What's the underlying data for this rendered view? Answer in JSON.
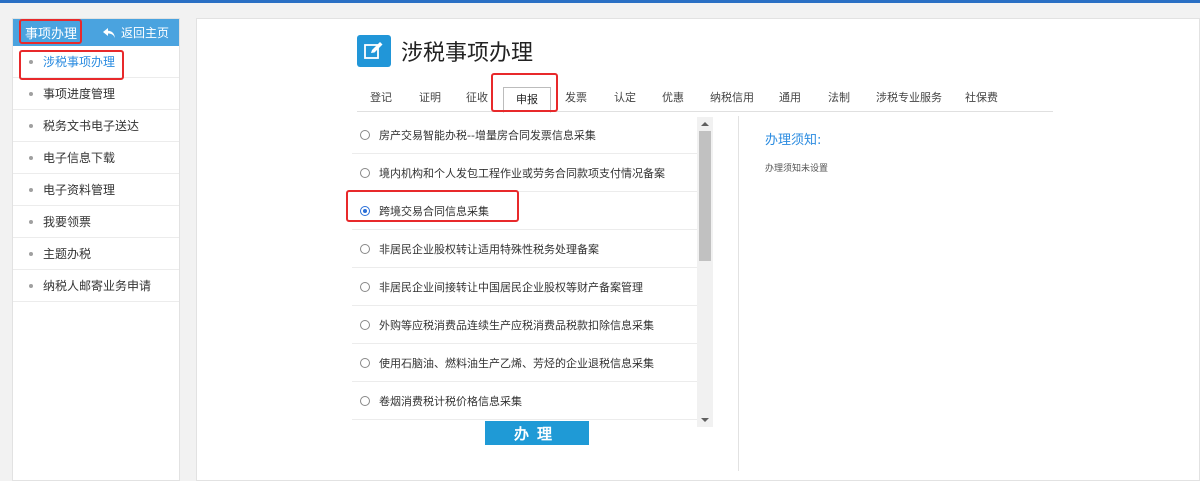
{
  "sidebar": {
    "title": "事项办理",
    "back_label": "返回主页",
    "items": [
      {
        "label": "涉税事项办理"
      },
      {
        "label": "事项进度管理"
      },
      {
        "label": "税务文书电子送达"
      },
      {
        "label": "电子信息下载"
      },
      {
        "label": "电子资料管理"
      },
      {
        "label": "我要领票"
      },
      {
        "label": "主题办税"
      },
      {
        "label": "纳税人邮寄业务申请"
      }
    ]
  },
  "main": {
    "title": "涉税事项办理",
    "tabs": [
      "登记",
      "证明",
      "征收",
      "申报",
      "发票",
      "认定",
      "优惠",
      "纳税信用",
      "通用",
      "法制",
      "涉税专业服务",
      "社保费"
    ],
    "active_tab": "申报",
    "options": [
      {
        "label": "房产交易智能办税--增量房合同发票信息采集",
        "selected": false
      },
      {
        "label": "境内机构和个人发包工程作业或劳务合同款项支付情况备案",
        "selected": false
      },
      {
        "label": "跨境交易合同信息采集",
        "selected": true
      },
      {
        "label": "非居民企业股权转让适用特殊性税务处理备案",
        "selected": false
      },
      {
        "label": "非居民企业间接转让中国居民企业股权等财产备案管理",
        "selected": false
      },
      {
        "label": "外购等应税消费品连续生产应税消费品税款扣除信息采集",
        "selected": false
      },
      {
        "label": "使用石脑油、燃料油生产乙烯、芳烃的企业退税信息采集",
        "selected": false
      },
      {
        "label": "卷烟消费税计税价格信息采集",
        "selected": false
      }
    ],
    "submit_label": "办理",
    "notice": {
      "title": "办理须知:",
      "text": "办理须知未设置"
    }
  },
  "colors": {
    "accent": "#2196d8",
    "sidebar_header": "#4aa3df",
    "highlight_box": "#e8292b",
    "active_link": "#2a8be0"
  },
  "icons": [
    "back-arrow-icon",
    "edit-icon",
    "scroll-up-icon",
    "scroll-down-icon"
  ]
}
